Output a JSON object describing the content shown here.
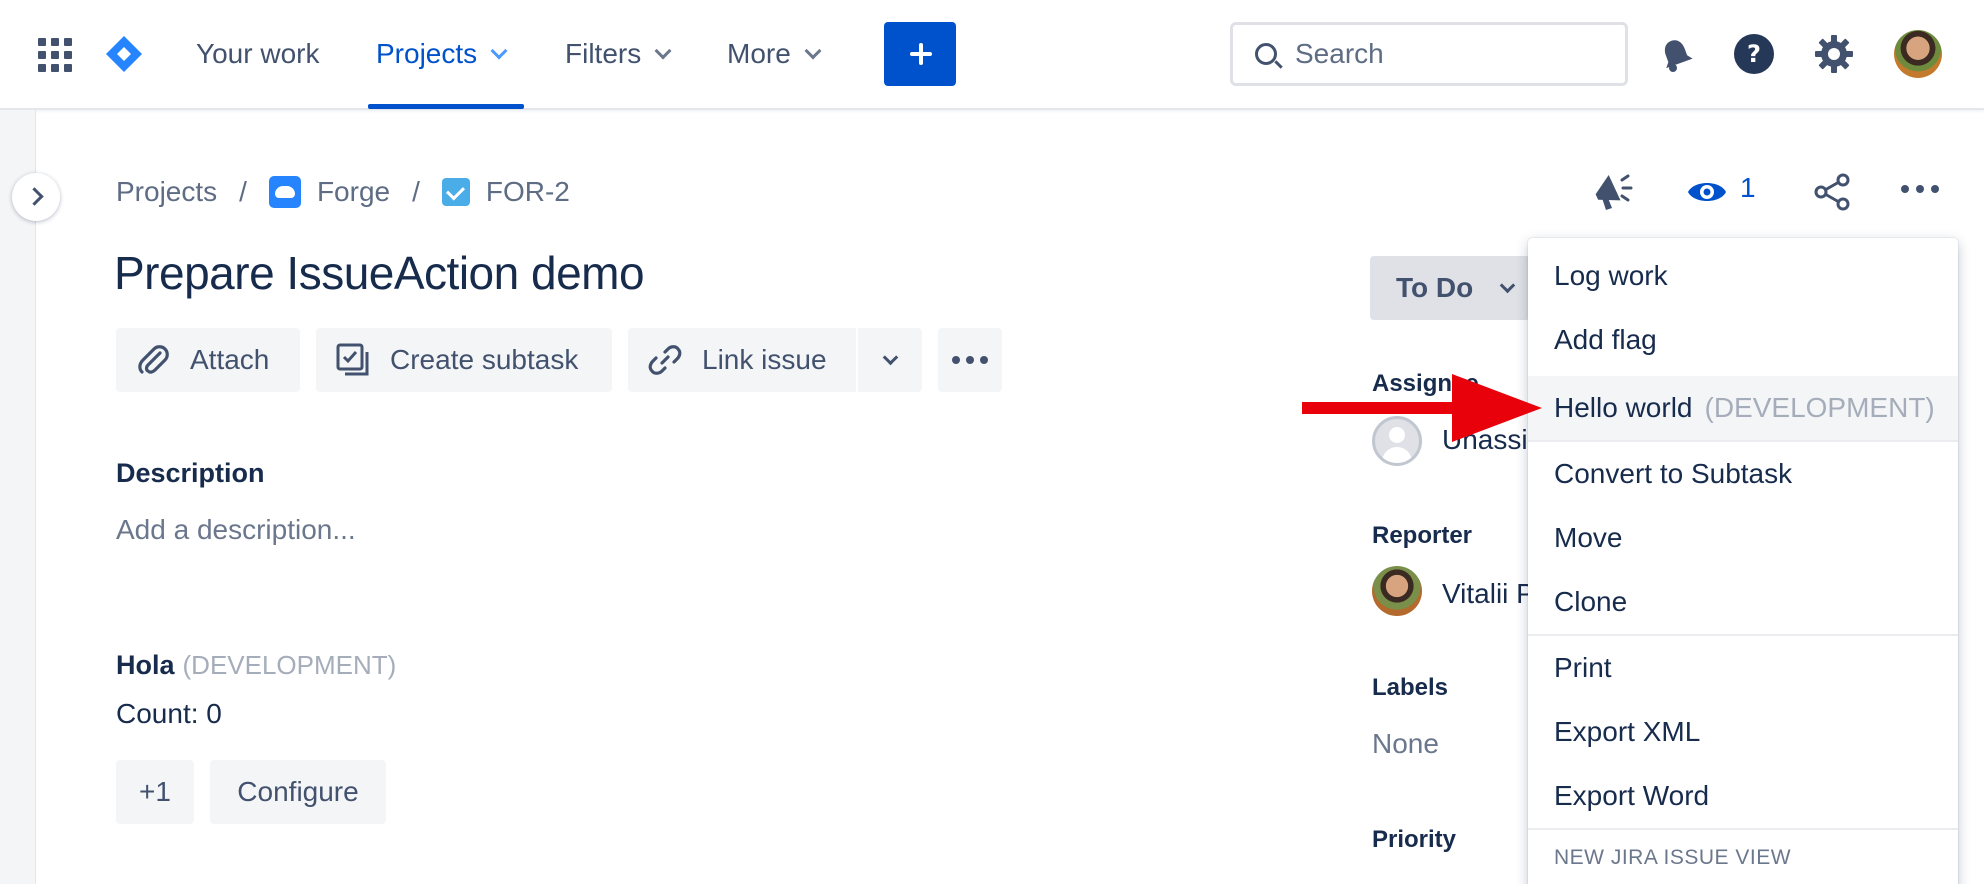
{
  "nav": {
    "items": [
      {
        "label": "Your work"
      },
      {
        "label": "Projects"
      },
      {
        "label": "Filters"
      },
      {
        "label": "More"
      }
    ],
    "search_placeholder": "Search"
  },
  "breadcrumb": {
    "root": "Projects",
    "project": "Forge",
    "issue_key": "FOR-2",
    "separator": "/"
  },
  "issue": {
    "title": "Prepare IssueAction demo",
    "toolbar": {
      "attach": "Attach",
      "create_subtask": "Create subtask",
      "link_issue": "Link issue"
    },
    "description_label": "Description",
    "description_placeholder": "Add a description...",
    "app_panel": {
      "title": "Hola",
      "env": "(DEVELOPMENT)",
      "count_text": "Count: 0",
      "plus_button": "+1",
      "configure_button": "Configure"
    }
  },
  "header_actions": {
    "watch_count": "1"
  },
  "sidebar_fields": {
    "status": "To Do",
    "assignee_label": "Assignee",
    "assignee_value": "Unassi",
    "reporter_label": "Reporter",
    "reporter_value": "Vitalii P",
    "labels_label": "Labels",
    "labels_value": "None",
    "priority_label": "Priority"
  },
  "menu": {
    "items": [
      {
        "label": "Log work"
      },
      {
        "label": "Add flag"
      },
      {
        "label": "Hello world",
        "suffix": "(DEVELOPMENT)"
      },
      {
        "label": "Convert to Subtask"
      },
      {
        "label": "Move"
      },
      {
        "label": "Clone"
      },
      {
        "label": "Print"
      },
      {
        "label": "Export XML"
      },
      {
        "label": "Export Word"
      }
    ],
    "heading": "NEW JIRA ISSUE VIEW"
  },
  "colors": {
    "accent": "#0052CC",
    "annotation_arrow": "#E8000B"
  },
  "icons": [
    "app-switcher-icon",
    "jira-logo-icon",
    "plus-icon",
    "search-icon",
    "bell-icon",
    "help-icon",
    "gear-icon",
    "megaphone-icon",
    "eye-icon",
    "share-icon",
    "more-icon",
    "paperclip-icon",
    "subtask-icon",
    "link-icon"
  ]
}
